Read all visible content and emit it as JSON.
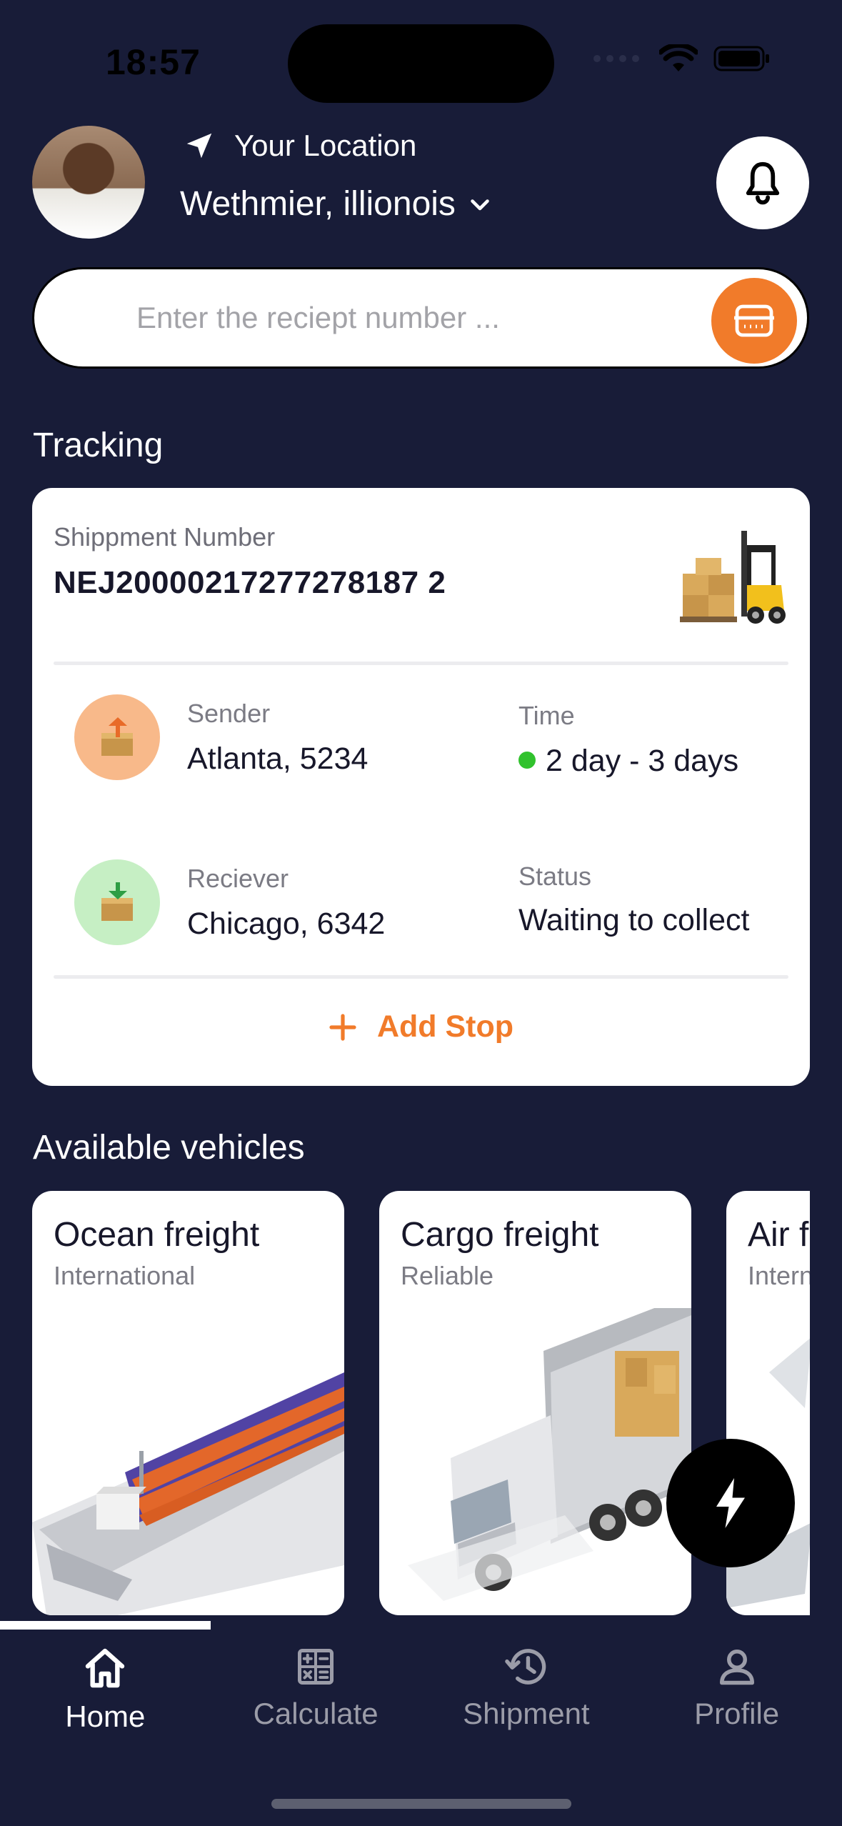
{
  "status_bar": {
    "time": "18:57"
  },
  "header": {
    "location_label": "Your Location",
    "location_value": "Wethmier, illionois"
  },
  "search": {
    "placeholder": "Enter the reciept number ..."
  },
  "tracking": {
    "section_title": "Tracking",
    "shipment_label": "Shippment Number",
    "shipment_number": "NEJ20000217277278187 2",
    "sender_label": "Sender",
    "sender_value": "Atlanta, 5234",
    "time_label": "Time",
    "time_value": "2 day - 3 days",
    "receiver_label": "Reciever",
    "receiver_value": "Chicago, 6342",
    "status_label": "Status",
    "status_value": "Waiting to collect",
    "add_stop_label": "Add Stop"
  },
  "vehicles": {
    "section_title": "Available vehicles",
    "items": [
      {
        "title": "Ocean freight",
        "subtitle": "International"
      },
      {
        "title": "Cargo freight",
        "subtitle": "Reliable"
      },
      {
        "title": "Air freight",
        "subtitle": "International"
      }
    ]
  },
  "nav": {
    "items": [
      {
        "label": "Home",
        "icon": "home-icon"
      },
      {
        "label": "Calculate",
        "icon": "calculator-icon"
      },
      {
        "label": "Shipment",
        "icon": "history-icon"
      },
      {
        "label": "Profile",
        "icon": "user-icon"
      }
    ]
  },
  "colors": {
    "background": "#181c38",
    "accent": "#f17b2a",
    "online": "#31c22d"
  }
}
